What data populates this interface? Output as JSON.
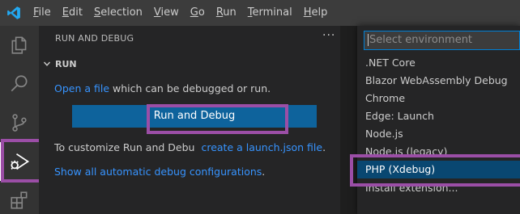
{
  "menubar": {
    "items": [
      {
        "accel": "F",
        "rest": "ile"
      },
      {
        "accel": "E",
        "rest": "dit"
      },
      {
        "accel": "S",
        "rest": "election"
      },
      {
        "accel": "V",
        "rest": "iew"
      },
      {
        "accel": "G",
        "rest": "o"
      },
      {
        "accel": "R",
        "rest": "un"
      },
      {
        "accel": "T",
        "rest": "erminal"
      },
      {
        "accel": "H",
        "rest": "elp"
      }
    ]
  },
  "activitybar": {
    "icons": [
      "explorer-icon",
      "search-icon",
      "source-control-icon",
      "run-debug-icon",
      "extensions-icon"
    ],
    "active": "run-debug-icon"
  },
  "sidebar": {
    "title": "RUN AND DEBUG",
    "more": "···",
    "section": "RUN",
    "open_file_link": "Open a file",
    "open_file_rest": " which can be debugged or run.",
    "run_button": "Run and Debug",
    "customize_prefix": "To customize Run and Debu",
    "launch_link": "create a launch.json file",
    "launch_suffix": ".",
    "show_all_link": "Show all automatic debug configurations",
    "show_all_suffix": "."
  },
  "quickpick": {
    "placeholder": "Select environment",
    "items": [
      ".NET Core",
      "Blazor WebAssembly Debug",
      "Chrome",
      "Edge: Launch",
      "Node.js",
      "Node.js (legacy)",
      "PHP (Xdebug)",
      "Install extension..."
    ],
    "selected_index": 6
  },
  "colors": {
    "accent": "#007acc",
    "button": "#0e639c",
    "link": "#3794ff",
    "highlight_frame": "#9b4ea6",
    "selection": "#094771"
  }
}
